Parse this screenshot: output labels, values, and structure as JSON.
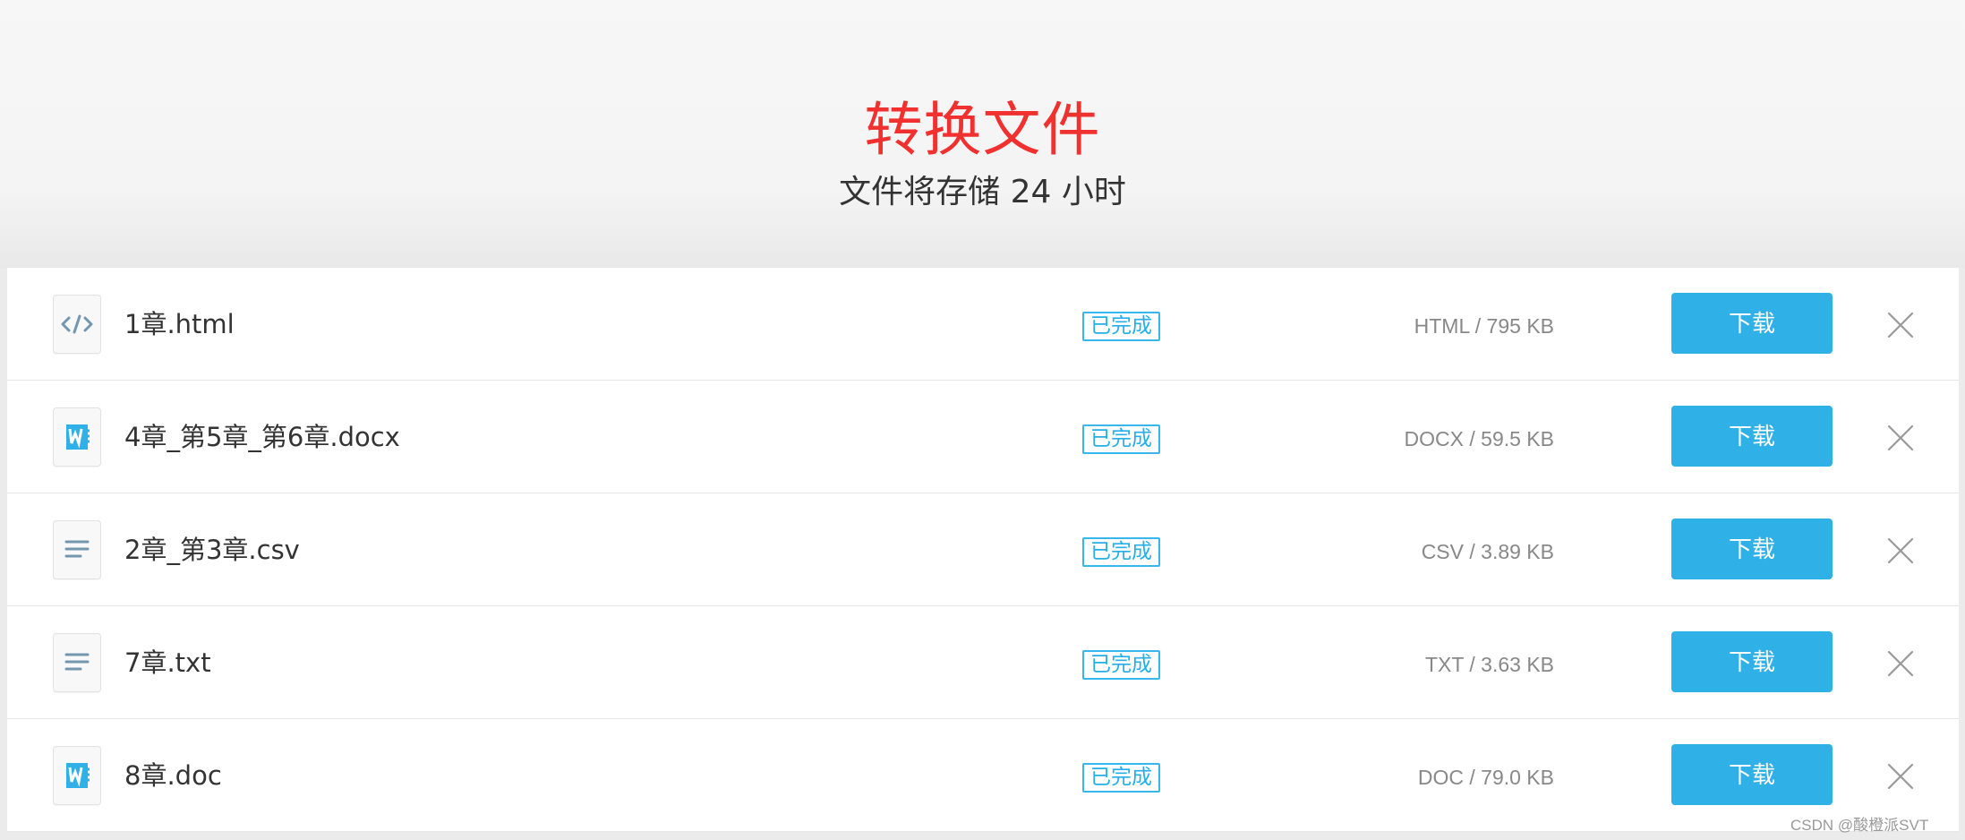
{
  "header": {
    "title": "转换文件",
    "subtitle": "文件将存储 24 小时"
  },
  "files": [
    {
      "name": "1章.html",
      "icon": "code-file-icon",
      "status": "已完成",
      "meta": "HTML / 795 KB",
      "download_label": "下载"
    },
    {
      "name": "4章_第5章_第6章.docx",
      "icon": "word-file-icon",
      "status": "已完成",
      "meta": "DOCX / 59.5 KB",
      "download_label": "下载"
    },
    {
      "name": "2章_第3章.csv",
      "icon": "text-lines-icon",
      "status": "已完成",
      "meta": "CSV / 3.89 KB",
      "download_label": "下载"
    },
    {
      "name": "7章.txt",
      "icon": "text-lines-icon",
      "status": "已完成",
      "meta": "TXT / 3.63 KB",
      "download_label": "下载"
    },
    {
      "name": "8章.doc",
      "icon": "word-file-icon",
      "status": "已完成",
      "meta": "DOC / 79.0 KB",
      "download_label": "下载"
    }
  ],
  "colors": {
    "title": "#f0312f",
    "accent": "#2fb0e7",
    "status": "#25aee7"
  },
  "watermark": "CSDN @酸橙派SVT"
}
